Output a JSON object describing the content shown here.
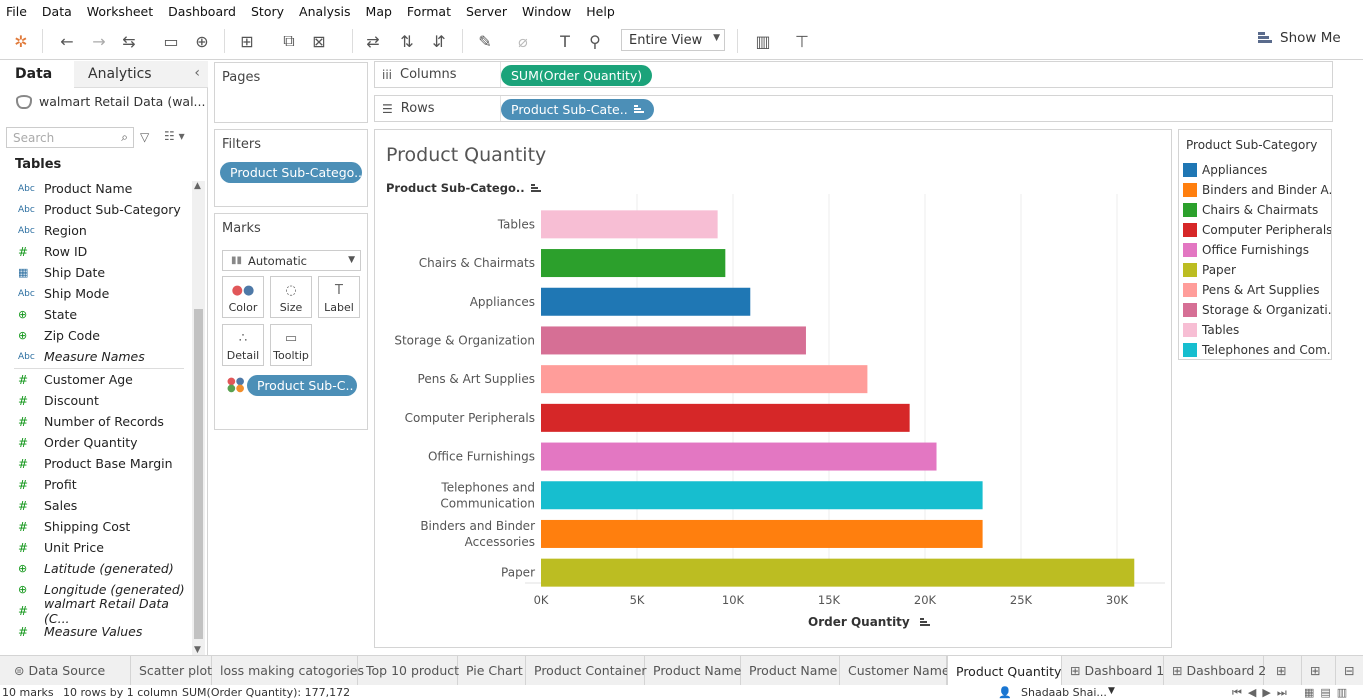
{
  "menu": [
    "File",
    "Data",
    "Worksheet",
    "Dashboard",
    "Story",
    "Analysis",
    "Map",
    "Format",
    "Server",
    "Window",
    "Help"
  ],
  "toolbar": {
    "fit_label": "Entire View",
    "show_me_label": "Show Me"
  },
  "left_pane": {
    "tab_data": "Data",
    "tab_analytics": "Analytics",
    "datasource": "walmart Retail Data (wal...",
    "search_placeholder": "Search",
    "tables_heading": "Tables",
    "dimensions": [
      {
        "type": "Abc",
        "name": "Product Name"
      },
      {
        "type": "Abc",
        "name": "Product Sub-Category"
      },
      {
        "type": "Abc",
        "name": "Region"
      },
      {
        "type": "#",
        "name": "Row ID"
      },
      {
        "type": "date",
        "name": "Ship Date"
      },
      {
        "type": "Abc",
        "name": "Ship Mode"
      },
      {
        "type": "globe",
        "name": "State"
      },
      {
        "type": "globe",
        "name": "Zip Code"
      },
      {
        "type": "Abc",
        "name": "Measure Names"
      }
    ],
    "measures": [
      {
        "type": "#",
        "name": "Customer Age"
      },
      {
        "type": "#",
        "name": "Discount"
      },
      {
        "type": "#",
        "name": "Number of Records"
      },
      {
        "type": "#",
        "name": "Order Quantity"
      },
      {
        "type": "#",
        "name": "Product Base Margin"
      },
      {
        "type": "#",
        "name": "Profit"
      },
      {
        "type": "#",
        "name": "Sales"
      },
      {
        "type": "#",
        "name": "Shipping Cost"
      },
      {
        "type": "#",
        "name": "Unit Price"
      },
      {
        "type": "globe",
        "name": "Latitude (generated)"
      },
      {
        "type": "globe",
        "name": "Longitude (generated)"
      },
      {
        "type": "#",
        "name": "walmart Retail Data (C..."
      },
      {
        "type": "#",
        "name": "Measure Values"
      }
    ]
  },
  "cards": {
    "pages": "Pages",
    "filters": "Filters",
    "filter_pill": "Product Sub-Catego..",
    "marks": "Marks",
    "mark_type": "Automatic",
    "buttons": [
      "Color",
      "Size",
      "Label",
      "Detail",
      "Tooltip"
    ],
    "marks_pill": "Product Sub-C.."
  },
  "shelves": {
    "columns_label": "Columns",
    "columns_pill": "SUM(Order Quantity)",
    "rows_label": "Rows",
    "rows_pill": "Product Sub-Cate.."
  },
  "view": {
    "title": "Product Quantity",
    "row_header": "Product Sub-Catego..",
    "axis_title": "Order Quantity"
  },
  "chart_data": {
    "type": "bar",
    "orientation": "horizontal",
    "title": "Product Quantity",
    "xlabel": "Order Quantity",
    "ylabel": "Product Sub-Category",
    "xlim": [
      0,
      32500
    ],
    "xticks": [
      "0K",
      "5K",
      "10K",
      "15K",
      "20K",
      "25K",
      "30K"
    ],
    "grid": true,
    "categories": [
      {
        "label": [
          "Tables"
        ],
        "value": 9200,
        "color": "#f7bed4"
      },
      {
        "label": [
          "Chairs & Chairmats"
        ],
        "value": 9600,
        "color": "#2ca02c"
      },
      {
        "label": [
          "Appliances"
        ],
        "value": 10900,
        "color": "#1f77b4"
      },
      {
        "label": [
          "Storage & Organization"
        ],
        "value": 13800,
        "color": "#d66f95"
      },
      {
        "label": [
          "Pens & Art Supplies"
        ],
        "value": 17000,
        "color": "#ff9d9a"
      },
      {
        "label": [
          "Computer Peripherals"
        ],
        "value": 19200,
        "color": "#d62728"
      },
      {
        "label": [
          "Office Furnishings"
        ],
        "value": 20600,
        "color": "#e377c2"
      },
      {
        "label": [
          "Telephones and",
          "Communication"
        ],
        "value": 23000,
        "color": "#17becf"
      },
      {
        "label": [
          "Binders and Binder",
          "Accessories"
        ],
        "value": 23000,
        "color": "#ff7f0e"
      },
      {
        "label": [
          "Paper"
        ],
        "value": 30900,
        "color": "#bcbd22"
      }
    ]
  },
  "legend": {
    "title": "Product Sub-Category",
    "items": [
      {
        "label": "Appliances",
        "color": "#1f77b4"
      },
      {
        "label": "Binders and Binder A..",
        "color": "#ff7f0e"
      },
      {
        "label": "Chairs & Chairmats",
        "color": "#2ca02c"
      },
      {
        "label": "Computer Peripherals",
        "color": "#d62728"
      },
      {
        "label": "Office Furnishings",
        "color": "#e377c2"
      },
      {
        "label": "Paper",
        "color": "#bcbd22"
      },
      {
        "label": "Pens & Art Supplies",
        "color": "#ff9d9a"
      },
      {
        "label": "Storage & Organizati..",
        "color": "#d66f95"
      },
      {
        "label": "Tables",
        "color": "#f7bed4"
      },
      {
        "label": "Telephones and Com..",
        "color": "#17becf"
      }
    ]
  },
  "bottom_tabs": [
    "Data Source",
    "Scatter plot",
    "loss making catogories",
    "Top 10 product",
    "Pie Chart",
    "Product Container",
    "Product Name",
    "Product Name",
    "Customer Name",
    "Product Quantity",
    "Dashboard 1",
    "Dashboard 2"
  ],
  "active_tab": "Product Quantity",
  "status": {
    "marks": "10 marks",
    "rows": "10 rows by 1 column",
    "sum": "SUM(Order Quantity): 177,172",
    "user": "Shadaab Shai..."
  }
}
